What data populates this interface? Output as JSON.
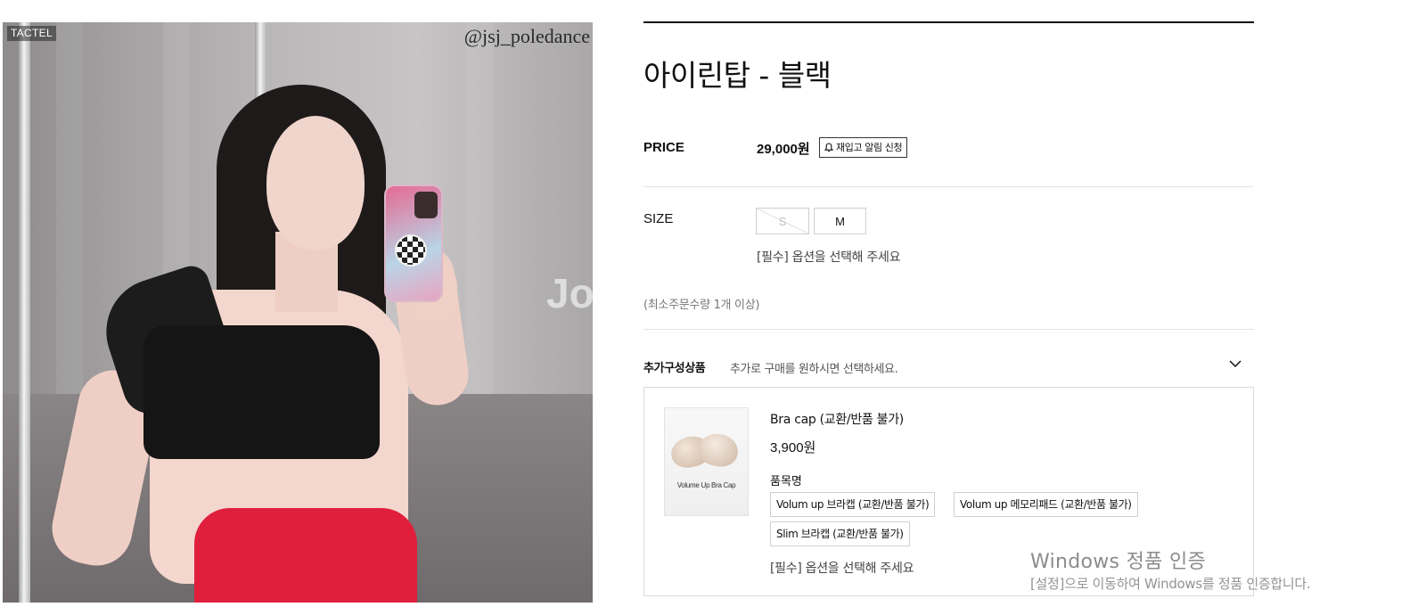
{
  "photo": {
    "badge": "TACTEL",
    "handle": "@jsj_poledance",
    "watermark": "Jo"
  },
  "product": {
    "title": "아이린탑 - 블랙",
    "price_label": "PRICE",
    "price": "29,000원",
    "restock_label": "재입고 알림 신청",
    "size_label": "SIZE",
    "sizes": [
      {
        "label": "S",
        "sold_out": true
      },
      {
        "label": "M",
        "sold_out": false
      }
    ],
    "size_required": "[필수] 옵션을 선택해 주세요",
    "min_order": "(최소주문수량 1개 이상)"
  },
  "addon": {
    "title": "추가구성상품",
    "description": "추가로 구매를 원하시면 선택하세요.",
    "item": {
      "image_caption": "Volume Up Bra Cap",
      "name": "Bra cap (교환/반품 불가)",
      "price": "3,900원",
      "option_label": "품목명",
      "options": [
        "Volum up 브라캡 (교환/반품 불가)",
        "Volum up 메모리패드 (교환/반품 불가)",
        "Slim 브라캡 (교환/반품 불가)"
      ],
      "required": "[필수] 옵션을 선택해 주세요"
    }
  },
  "windows_activation": {
    "title": "Windows 정품 인증",
    "message": "[설정]으로 이동하여 Windows를 정품 인증합니다."
  }
}
